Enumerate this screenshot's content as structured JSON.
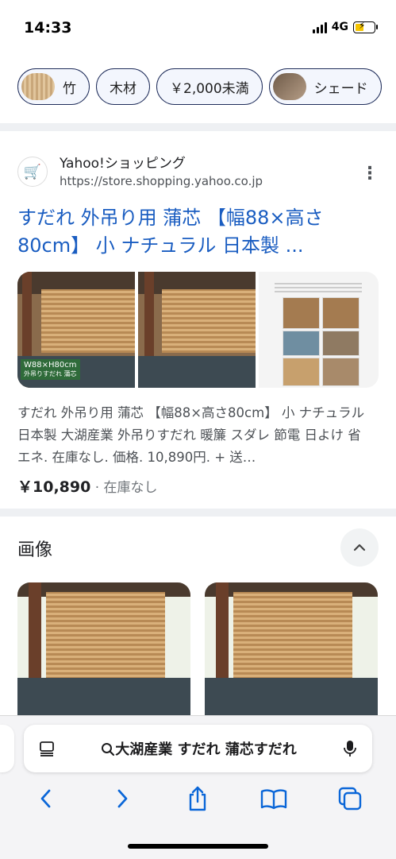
{
  "status": {
    "time": "14:33",
    "network": "4G",
    "battery_level": 0.5
  },
  "chips": [
    {
      "label": "竹",
      "has_thumb": true
    },
    {
      "label": "木材",
      "has_thumb": false
    },
    {
      "label": "￥2,000未満",
      "has_thumb": false
    },
    {
      "label": "シェード",
      "has_thumb": true
    }
  ],
  "result": {
    "site_name": "Yahoo!ショッピング",
    "site_url": "https://store.shopping.yahoo.co.jp",
    "title": "すだれ 外吊り用 蒲芯 【幅88×高さ80cm】 小 ナチュラル 日本製 ...",
    "image1_badge": "W88×H80cm",
    "image1_badge2": "外吊りすだれ 蒲芯",
    "snippet": "すだれ 外吊り用 蒲芯 【幅88×高さ80cm】 小 ナチュラル 日本製 大湖産業 外吊りすだれ 暖簾 スダレ 節電 日よけ 省エネ. 在庫なし. 価格. 10,890円. + 送…",
    "price": "￥10,890",
    "availability": "· 在庫なし"
  },
  "images_section": {
    "title": "画像"
  },
  "address_bar": {
    "query": "大湖産業 すだれ 蒲芯すだれ"
  },
  "icons": [
    "cart-icon",
    "kebab-icon",
    "chevron-up-icon",
    "tabs-icon",
    "search-icon",
    "mic-icon",
    "back-icon",
    "forward-icon",
    "share-icon",
    "bookmarks-icon",
    "tabs-overview-icon"
  ],
  "colors": {
    "link": "#1a5dc1",
    "chip_border": "#1f2d5a",
    "toolbar_icon": "#0a66d8"
  }
}
